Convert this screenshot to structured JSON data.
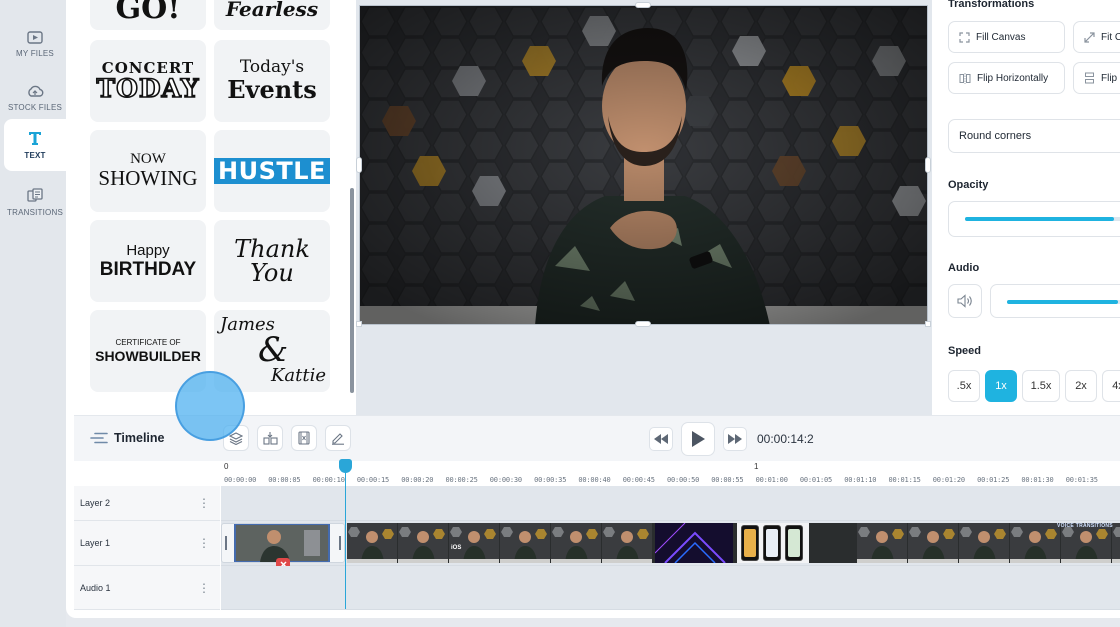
{
  "nav": {
    "items": [
      {
        "label": "MY FILES",
        "icon": "folder-play-icon"
      },
      {
        "label": "STOCK FILES",
        "icon": "cloud-icon"
      },
      {
        "label": "TEXT",
        "icon": "text-t-icon",
        "active": true
      },
      {
        "label": "TRANSITIONS",
        "icon": "transitions-icon"
      }
    ]
  },
  "text_templates": {
    "items": [
      {
        "lines": [
          "GO!"
        ]
      },
      {
        "lines": [
          "Fearless"
        ]
      },
      {
        "lines": [
          "CONCERT",
          "TODAY"
        ]
      },
      {
        "lines": [
          "Today's",
          "Events"
        ]
      },
      {
        "lines": [
          "NOW",
          "SHOWING"
        ]
      },
      {
        "lines": [
          "HUSTLE"
        ]
      },
      {
        "lines": [
          "Happy",
          "BIRTHDAY"
        ]
      },
      {
        "lines": [
          "Thank",
          "You"
        ]
      },
      {
        "lines": [
          "CERTIFICATE OF",
          "SHOWBUILDER"
        ]
      },
      {
        "lines": [
          "James",
          "&",
          "Kattie"
        ]
      }
    ]
  },
  "properties": {
    "transformations_label": "Transformations",
    "fill_canvas": "Fill Canvas",
    "fit_canvas": "Fit C",
    "flip_horizontally": "Flip Horizontally",
    "flip_vertically": "Flip",
    "round_corners": "Round corners",
    "opacity_label": "Opacity",
    "opacity_level": 0.85,
    "audio_label": "Audio",
    "audio_level": 0.85,
    "speed_label": "Speed",
    "speeds": [
      ".5x",
      "1x",
      "1.5x",
      "2x",
      "4x"
    ],
    "speed_selected": "1x"
  },
  "timeline": {
    "title": "Timeline",
    "timecode": "00:00:14:2",
    "minute_marks": [
      "0",
      "1"
    ],
    "ticks": [
      "00:00:00",
      "00:00:05",
      "00:00:10",
      "00:00:15",
      "00:00:20",
      "00:00:25",
      "00:00:30",
      "00:00:35",
      "00:00:40",
      "00:00:45",
      "00:00:50",
      "00:00:55",
      "00:01:00",
      "00:01:05",
      "00:01:10",
      "00:01:15",
      "00:01:20",
      "00:01:25",
      "00:01:30",
      "00:01:35"
    ],
    "tracks": [
      {
        "label": "Layer 2"
      },
      {
        "label": "Layer 1"
      },
      {
        "label": "Audio 1"
      }
    ],
    "clip_overlay_text": "VOICE TRANSITIONS",
    "phone_text": "iOS"
  },
  "colors": {
    "accent": "#1fb3e0",
    "playhead": "#2aa6d8",
    "delete": "#e04848",
    "cursor": "#4aaef0"
  }
}
